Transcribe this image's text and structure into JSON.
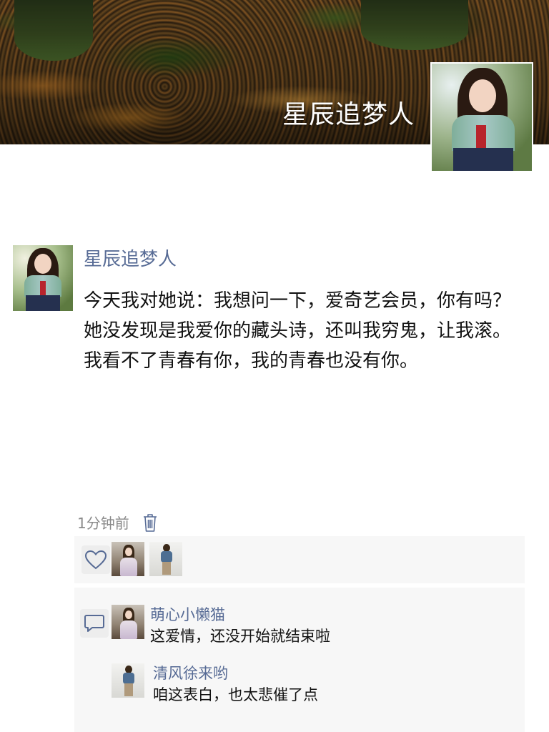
{
  "profile": {
    "name": "星辰追梦人"
  },
  "post": {
    "author": "星辰追梦人",
    "content": "今天我对她说：我想问一下，爱奇艺会员，你有吗？她没发现是我爱你的藏头诗，还叫我穷鬼，让我滚。我看不了青春有你，我的青春也没有你。",
    "time": "1分钟前"
  },
  "comments": [
    {
      "author": "萌心小懒猫",
      "text": "这爱情，还没开始就结束啦"
    },
    {
      "author": "清风徐来哟",
      "text": "咱这表白，也太悲催了点"
    }
  ],
  "colors": {
    "link": "#576b95",
    "panel": "#f7f7f7",
    "icon": "#576b95"
  },
  "icons": [
    "trash-icon",
    "heart-icon",
    "comment-icon"
  ]
}
